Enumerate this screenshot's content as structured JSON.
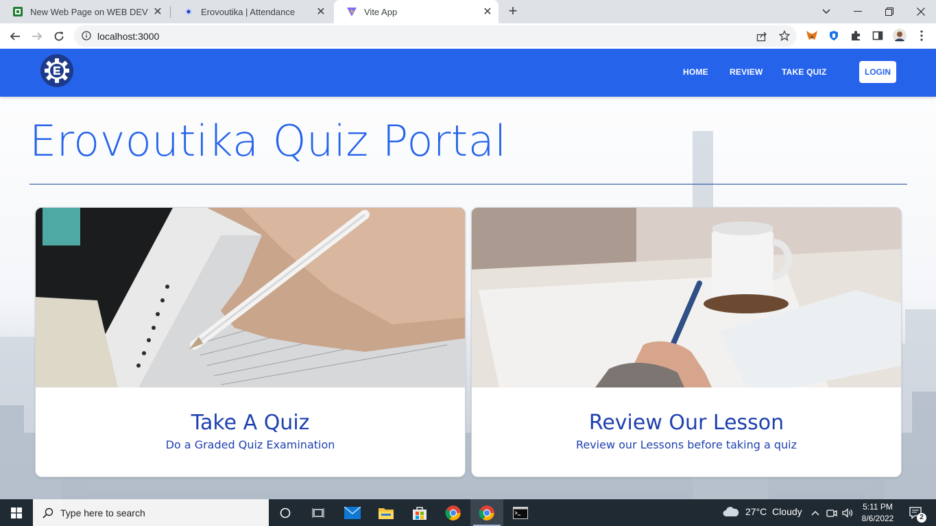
{
  "browser": {
    "tabs": [
      {
        "title": "New Web Page on WEB DEV OUT",
        "favicon": "green-page-icon"
      },
      {
        "title": "Erovoutika | Attendance",
        "favicon": "blue-dot-icon"
      },
      {
        "title": "Vite App",
        "favicon": "vite-icon",
        "active": true
      }
    ],
    "new_tab_label": "+",
    "address": "localhost:3000"
  },
  "site": {
    "nav": {
      "links": [
        "HOME",
        "REVIEW",
        "TAKE QUIZ"
      ],
      "login": "LOGIN"
    },
    "brand_color": "#2563eb",
    "page_title": "Erovoutika Quiz Portal",
    "cards": [
      {
        "title": "Take A Quiz",
        "subtitle": "Do a Graded Quiz Examination",
        "image": "answer-sheet-photo"
      },
      {
        "title": "Review Our Lesson",
        "subtitle": "Review our Lessons before taking a quiz",
        "image": "writing-desk-photo"
      }
    ]
  },
  "taskbar": {
    "search_placeholder": "Type here to search",
    "weather": "27°C  Cloudy",
    "time": "5:11 PM",
    "date": "8/6/2022",
    "notifications": "2"
  }
}
